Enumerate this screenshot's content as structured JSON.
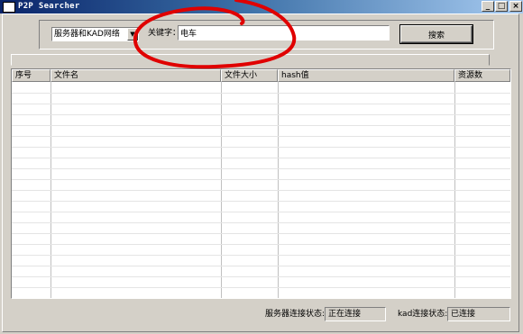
{
  "window": {
    "title": "P2P Searcher",
    "min_glyph": "_",
    "max_glyph": "□",
    "close_glyph": "×"
  },
  "search": {
    "scope_selected": "服务器和KAD网络",
    "keyword_label": "关键字：",
    "keyword_value": "电车",
    "search_button": "搜索"
  },
  "table": {
    "columns": [
      "序号",
      "文件名",
      "文件大小",
      "hash值",
      "资源数"
    ],
    "rows": []
  },
  "status": {
    "server_label": "服务器连接状态:",
    "server_value": "正在连接",
    "kad_label": "kad连接状态:",
    "kad_value": "已连接"
  },
  "colors": {
    "annotation_stroke": "#e00000",
    "titlebar_start": "#0a246a",
    "titlebar_end": "#a6caf0",
    "face": "#d4d0c8"
  }
}
